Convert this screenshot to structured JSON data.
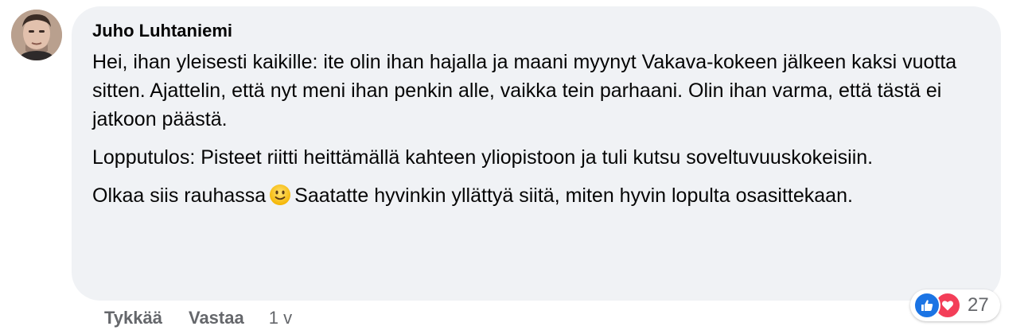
{
  "comment": {
    "author": "Juho Luhtaniemi",
    "paragraphs": [
      "Hei, ihan yleisesti kaikille: ite olin ihan hajalla ja maani myynyt Vakava-kokeen jälkeen kaksi vuotta sitten. Ajattelin, että nyt meni ihan penkin alle, vaikka tein parhaani. Olin ihan varma, että tästä ei jatkoon päästä.",
      "Lopputulos: Pisteet riitti heittämällä kahteen yliopistoon ja tuli kutsu soveltuvuuskokeisiin."
    ],
    "last_paragraph_before_emoji": "Olkaa siis rauhassa",
    "last_paragraph_after_emoji": "Saatatte hyvinkin yllättyä siitä, miten hyvin lopulta osasittekaan."
  },
  "actions": {
    "like_label": "Tykkää",
    "reply_label": "Vastaa",
    "timestamp": "1 v"
  },
  "reactions": {
    "icons": [
      "like-icon",
      "love-icon"
    ],
    "count": "27"
  },
  "colors": {
    "bubble": "#f0f2f5",
    "text": "#050505",
    "secondary": "#65676b",
    "like_blue": "#1b74e4",
    "love_red": "#f33e58"
  }
}
